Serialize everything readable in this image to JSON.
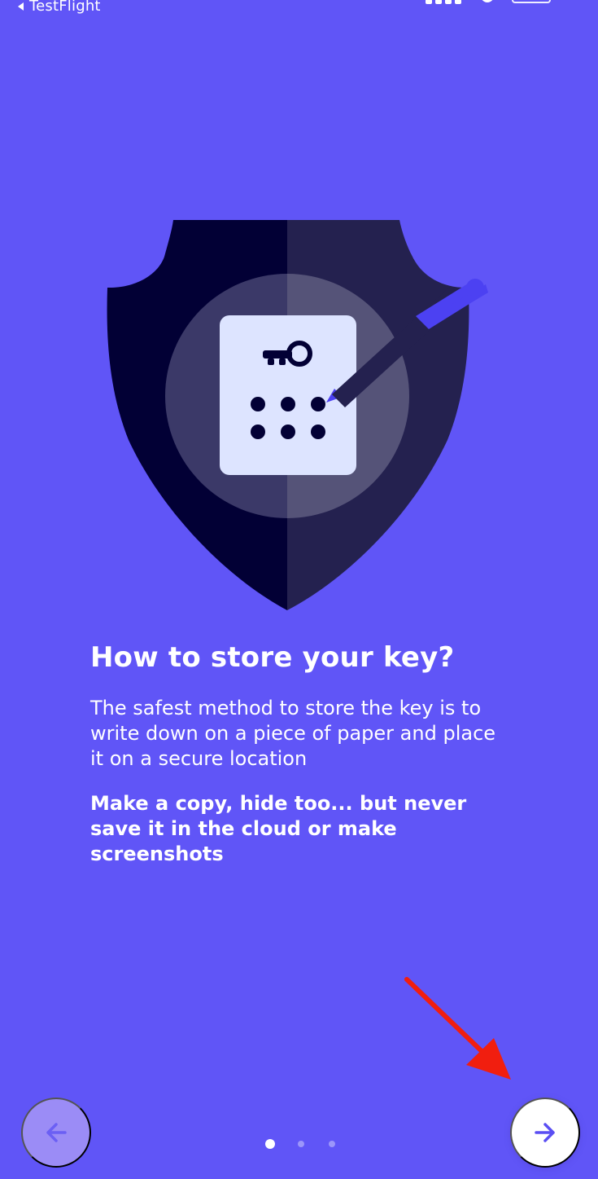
{
  "status_bar": {
    "back_label": "TestFlight",
    "back_icon": "chevron-left-icon",
    "signal_icon": "signal-icon",
    "wifi_icon": "wifi-icon",
    "battery_icon": "battery-icon"
  },
  "hero": {
    "illustration_icon": "shield-key-pen-illustration",
    "key_icon": "key-icon",
    "pen_icon": "pen-icon"
  },
  "content": {
    "title": "How to store your key?",
    "body": "The safest method to store the key is to write down on a piece of paper and place it on a secure location",
    "emphasis": "Make a copy, hide too... but never save it in the cloud or make screenshots"
  },
  "navigation": {
    "previous_icon": "arrow-left-icon",
    "next_icon": "arrow-right-icon"
  },
  "pagination": {
    "count": 3,
    "active_index": 0
  },
  "colors": {
    "background": "#6055F7",
    "shield_dark": "#020035",
    "shield_light": "#24214F",
    "card": "#DDE4FF",
    "pen": "#4C41F2",
    "prev_button": "#9B8CF6",
    "next_button": "#FFFFFF",
    "arrow": "#5A4EF3",
    "annotation_arrow": "#F11E0F"
  }
}
